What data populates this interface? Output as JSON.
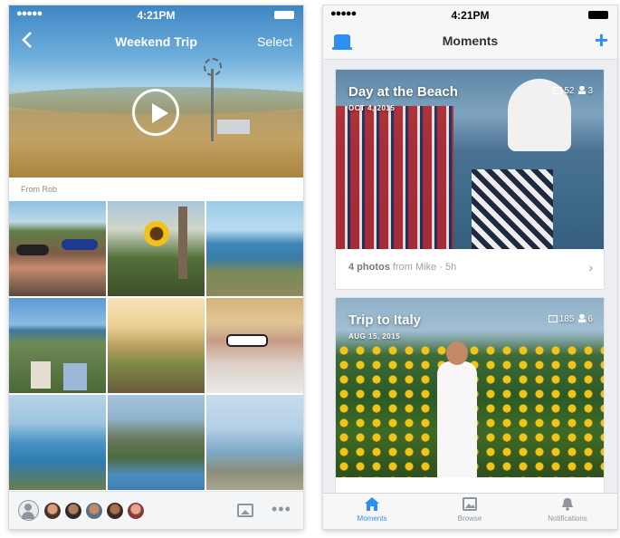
{
  "status_bar": {
    "signal": "●●●●●",
    "time": "4:21PM"
  },
  "album": {
    "title": "Weekend Trip",
    "select_label": "Select",
    "from_label": "From Rob",
    "more_label": "•••"
  },
  "moments": {
    "title": "Moments",
    "cards": [
      {
        "title": "Day at the Beach",
        "date": "OCT 4, 2015",
        "photos": "52",
        "people": "3",
        "count_label": "4 photos",
        "from_label": "from Mike · 5h"
      },
      {
        "title": "Trip to Italy",
        "date": "AUG 15, 2015",
        "photos": "185",
        "people": "6"
      }
    ],
    "tabs": [
      {
        "label": "Moments",
        "icon": "home-icon"
      },
      {
        "label": "Browse",
        "icon": "photo-icon"
      },
      {
        "label": "Notifications",
        "icon": "bell-icon"
      }
    ]
  },
  "colors": {
    "accent": "#2d8ff3",
    "tab_inactive": "#8e959c"
  }
}
